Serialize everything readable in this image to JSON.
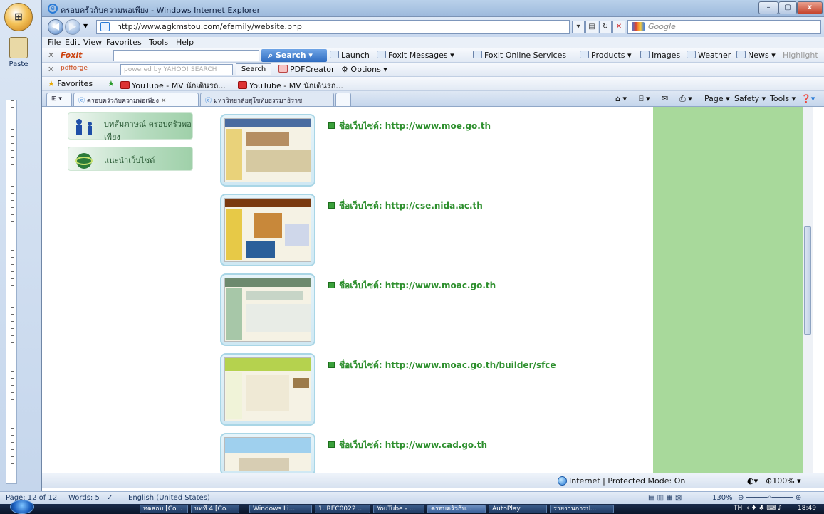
{
  "word": {
    "office_button": "",
    "paste_label": "Paste",
    "status": {
      "page": "Page: 12 of 12",
      "words": "Words: 5",
      "language": "English (United States)",
      "zoom": "130%"
    }
  },
  "window": {
    "title": "ครอบครัวกับความพอเพียง - Windows Internet Explorer",
    "min": "–",
    "max": "▢",
    "close": "x"
  },
  "address": {
    "url": "http://www.agkmstou.com/efamily/website.php",
    "search_engine": "Google"
  },
  "menu": [
    "File",
    "Edit",
    "View",
    "Favorites",
    "Tools",
    "Help"
  ],
  "foxit": {
    "brand": "Foxit",
    "search": "Search",
    "items": [
      "Launch",
      "Foxit Messages",
      "Foxit Online Services",
      "Products",
      "Images",
      "Weather",
      "News",
      "Highlight"
    ]
  },
  "yahoo": {
    "brand": "pdfforge",
    "box_text": "powered by YAHOO! SEARCH",
    "search": "Search",
    "pdfcreator": "PDFCreator",
    "options": "Options"
  },
  "favorites": {
    "label": "Favorites",
    "items": [
      "YouTube - MV นักเดินรถ...",
      "YouTube - MV นักเดินรถ..."
    ]
  },
  "tabs": {
    "active": "ครอบครัวกับความพอเพียง",
    "inactive": "มหาวิทยาลัยสุโขทัยธรรมาธิราช",
    "tools": [
      "Page",
      "Safety",
      "Tools"
    ]
  },
  "sidebar": {
    "btn1": "บทสัมภาษณ์ ครอบครัวพอเพียง",
    "btn2": "แนะนำเว็บไซต์"
  },
  "sites": [
    {
      "label": "ชื่อเว็บไซต์: http://www.moe.go.th",
      "color": "#e9d27a"
    },
    {
      "label": "ชื่อเว็บไซต์: http://cse.nida.ac.th",
      "color": "#e7c947"
    },
    {
      "label": "ชื่อเว็บไซต์: http://www.moac.go.th",
      "color": "#a7c7a8"
    },
    {
      "label": "ชื่อเว็บไซต์: http://www.moac.go.th/builder/sfce",
      "color": "#b5d24e"
    },
    {
      "label": "ชื่อเว็บไซต์: http://www.cad.go.th",
      "color": "#9fd0ee"
    }
  ],
  "ie_status": {
    "zone": "Internet | Protected Mode: On",
    "zoom": "100%"
  },
  "taskbar": {
    "items": [
      "ทดสอบ [Co...",
      "บทที่ 4 [Co...",
      "Windows Li...",
      "1. REC0022 ...",
      "YouTube - ...",
      "ครอบครัวกับ...",
      "AutoPlay",
      "รายงานการป..."
    ],
    "lang": "TH",
    "clock": "18:49"
  }
}
